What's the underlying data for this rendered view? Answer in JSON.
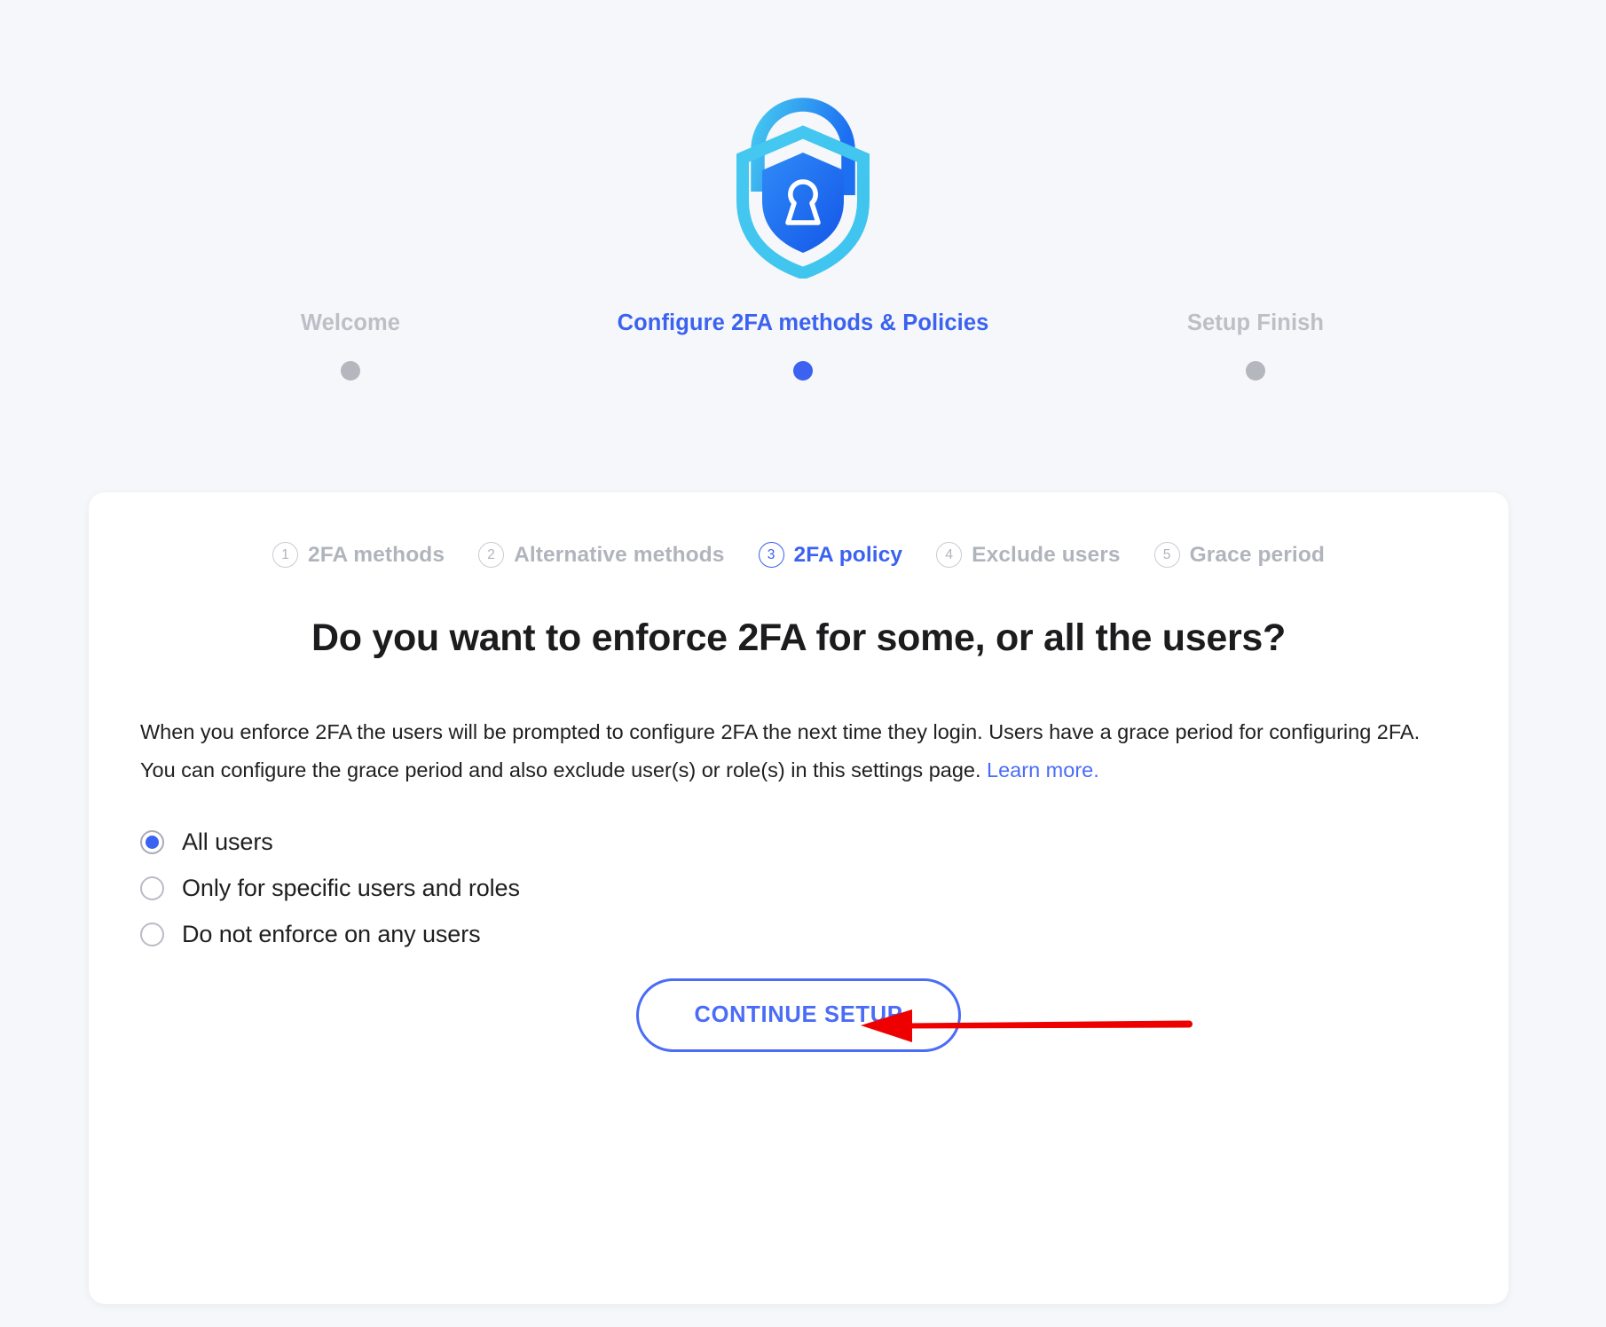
{
  "logo": {
    "name": "2fa-shield-lock-logo",
    "outer_color": "#45c8f0",
    "inner_color": "#1d6ff2",
    "accent_color": "#2a86f7"
  },
  "wizard": {
    "steps": [
      {
        "label": "Welcome",
        "state": "inactive"
      },
      {
        "label": "Configure 2FA methods & Policies",
        "state": "active"
      },
      {
        "label": "Setup Finish",
        "state": "inactive"
      }
    ],
    "active_color": "#3b62f0",
    "inactive_color": "#b4b7bd"
  },
  "card": {
    "substeps": [
      {
        "number": "1",
        "label": "2FA methods",
        "state": "inactive"
      },
      {
        "number": "2",
        "label": "Alternative methods",
        "state": "inactive"
      },
      {
        "number": "3",
        "label": "2FA policy",
        "state": "active"
      },
      {
        "number": "4",
        "label": "Exclude users",
        "state": "inactive"
      },
      {
        "number": "5",
        "label": "Grace period",
        "state": "inactive"
      }
    ],
    "heading": "Do you want to enforce 2FA for some, or all the users?",
    "body": {
      "text": "When you enforce 2FA the users will be prompted to configure 2FA the next time they login. Users have a grace period for configuring 2FA. You can configure the grace period and also exclude user(s) or role(s) in this settings page. ",
      "link_label": "Learn more."
    },
    "options": [
      {
        "label": "All users",
        "selected": true
      },
      {
        "label": "Only for specific users and roles",
        "selected": false
      },
      {
        "label": "Do not enforce on any users",
        "selected": false
      }
    ],
    "cta_label": "CONTINUE SETUP"
  },
  "annotation": {
    "name": "red-arrow-pointing-to-continue-setup",
    "color": "#ee0000",
    "direction": "left"
  },
  "colors": {
    "page_background": "#f6f7fa",
    "card_background": "#ffffff",
    "accent_blue": "#4a6cf7",
    "text_primary": "#1f1f21",
    "text_muted": "#b0b4bc"
  }
}
